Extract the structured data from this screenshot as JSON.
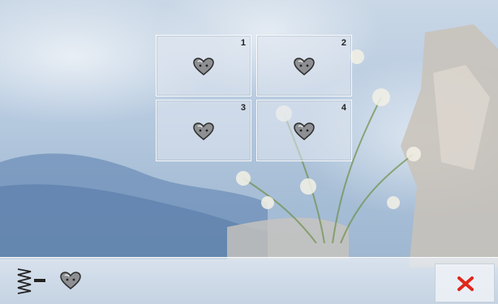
{
  "grid": {
    "tiles": [
      {
        "number": "1",
        "icon": "heart-icon"
      },
      {
        "number": "2",
        "icon": "heart-icon"
      },
      {
        "number": "3",
        "icon": "heart-icon"
      },
      {
        "number": "4",
        "icon": "heart-icon"
      }
    ]
  },
  "bottom_bar": {
    "stitch_icon": "zigzag-stitch-icon",
    "selected_icon": "heart-icon",
    "close_icon": "close-icon",
    "close_color": "#e0261b"
  }
}
